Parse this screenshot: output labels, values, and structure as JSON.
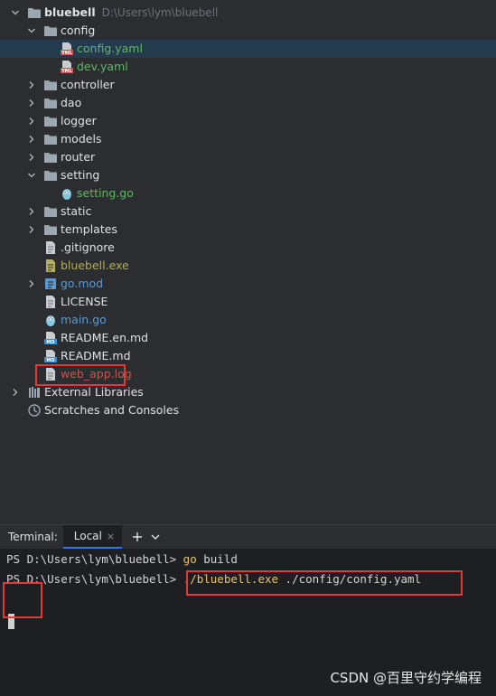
{
  "project": {
    "name": "bluebell",
    "path": "D:\\Users\\lym\\bluebell"
  },
  "tree": [
    {
      "label": "config",
      "kind": "folder",
      "level": 1,
      "expanded": true
    },
    {
      "label": "config.yaml",
      "kind": "yaml",
      "level": 2,
      "color": "green",
      "selected": true
    },
    {
      "label": "dev.yaml",
      "kind": "yaml",
      "level": 2,
      "color": "green"
    },
    {
      "label": "controller",
      "kind": "folder",
      "level": 1,
      "expanded": false
    },
    {
      "label": "dao",
      "kind": "folder",
      "level": 1,
      "expanded": false
    },
    {
      "label": "logger",
      "kind": "folder",
      "level": 1,
      "expanded": false
    },
    {
      "label": "models",
      "kind": "folder",
      "level": 1,
      "expanded": false
    },
    {
      "label": "router",
      "kind": "folder",
      "level": 1,
      "expanded": false
    },
    {
      "label": "setting",
      "kind": "folder",
      "level": 1,
      "expanded": true
    },
    {
      "label": "setting.go",
      "kind": "go",
      "level": 2,
      "color": "green"
    },
    {
      "label": "static",
      "kind": "folder",
      "level": 1,
      "expanded": false
    },
    {
      "label": "templates",
      "kind": "folder",
      "level": 1,
      "expanded": false
    },
    {
      "label": ".gitignore",
      "kind": "text",
      "level": 1,
      "color": "default"
    },
    {
      "label": "bluebell.exe",
      "kind": "exe",
      "level": 1,
      "color": "olive"
    },
    {
      "label": "go.mod",
      "kind": "gomod",
      "level": 1,
      "color": "blue",
      "expandable": true
    },
    {
      "label": "LICENSE",
      "kind": "text",
      "level": 1,
      "color": "default"
    },
    {
      "label": "main.go",
      "kind": "go",
      "level": 1,
      "color": "blue"
    },
    {
      "label": "README.en.md",
      "kind": "md",
      "level": 1,
      "color": "default"
    },
    {
      "label": "README.md",
      "kind": "md",
      "level": 1,
      "color": "default"
    },
    {
      "label": "web_app.log",
      "kind": "text",
      "level": 1,
      "color": "red"
    },
    {
      "label": "External Libraries",
      "kind": "libraries",
      "level": 0,
      "expandable": true
    },
    {
      "label": "Scratches and Consoles",
      "kind": "scratches",
      "level": 0
    }
  ],
  "terminal": {
    "title": "Terminal:",
    "tab_label": "Local",
    "tab_close": "×",
    "add_label": "+",
    "dropdown_label": "⌄",
    "lines": [
      {
        "prompt": "PS D:\\Users\\lym\\bluebell> ",
        "cmd": "go",
        "args": " build"
      },
      {
        "prompt": "PS D:\\Users\\lym\\bluebell> ",
        "cmd": "./bluebell.exe",
        "args": " ./config/config.yaml"
      }
    ]
  },
  "watermark": "CSDN @百里守约学编程",
  "colors": {
    "background": "#2b2d30",
    "terminal_background": "#1e1f22",
    "selection": "#243b4e",
    "highlight_box": "#e53935",
    "vcs_new_file": "#5fb865",
    "vcs_modified": "#5b9bd5",
    "vcs_ignored": "#b3ae60",
    "vcs_unversioned": "#c75450"
  }
}
